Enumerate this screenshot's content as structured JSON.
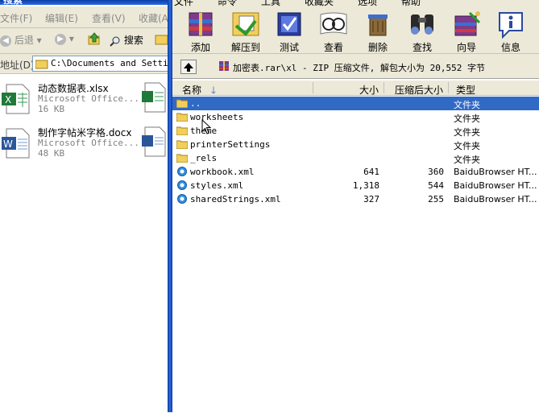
{
  "explorer": {
    "title": "搜索",
    "menu": [
      "文件(F)",
      "编辑(E)",
      "查看(V)",
      "收藏(A)"
    ],
    "nav": {
      "back_label": "后退",
      "search_label": "搜索"
    },
    "address": {
      "label": "地址(D)",
      "value": "C:\\Documents and Settings"
    },
    "files": [
      {
        "name": "动态数据表.xlsx",
        "desc": "Microsoft Office...",
        "size": "16 KB",
        "icon": "excel-file-icon"
      },
      {
        "name": "制作字帖米字格.docx",
        "desc": "Microsoft Office...",
        "size": "48 KB",
        "icon": "word-file-icon"
      }
    ]
  },
  "winrar": {
    "menu": [
      "文件",
      "命令",
      "工具",
      "收藏夹",
      "选项",
      "帮助"
    ],
    "toolbar": [
      {
        "label": "添加",
        "icon": "add-archive-icon"
      },
      {
        "label": "解压到",
        "icon": "extract-to-icon"
      },
      {
        "label": "测试",
        "icon": "test-icon"
      },
      {
        "label": "查看",
        "icon": "view-icon"
      },
      {
        "label": "删除",
        "icon": "delete-icon"
      },
      {
        "label": "查找",
        "icon": "find-icon"
      },
      {
        "label": "向导",
        "icon": "wizard-icon"
      },
      {
        "label": "信息",
        "icon": "info-icon"
      }
    ],
    "path": "加密表.rar\\xl - ZIP 压缩文件, 解包大小为 20,552 字节",
    "columns": {
      "name": "名称",
      "size": "大小",
      "packed": "压缩后大小",
      "type": "类型"
    },
    "rows": [
      {
        "name": "..",
        "size": "",
        "packed": "",
        "type": "文件夹",
        "kind": "folder",
        "selected": true
      },
      {
        "name": "worksheets",
        "size": "",
        "packed": "",
        "type": "文件夹",
        "kind": "folder"
      },
      {
        "name": "theme",
        "size": "",
        "packed": "",
        "type": "文件夹",
        "kind": "folder"
      },
      {
        "name": "printerSettings",
        "size": "",
        "packed": "",
        "type": "文件夹",
        "kind": "folder"
      },
      {
        "name": "_rels",
        "size": "",
        "packed": "",
        "type": "文件夹",
        "kind": "folder"
      },
      {
        "name": "workbook.xml",
        "size": "641",
        "packed": "360",
        "type": "BaiduBrowser HT...",
        "kind": "xml"
      },
      {
        "name": "styles.xml",
        "size": "1,318",
        "packed": "544",
        "type": "BaiduBrowser HT...",
        "kind": "xml"
      },
      {
        "name": "sharedStrings.xml",
        "size": "327",
        "packed": "255",
        "type": "BaiduBrowser HT...",
        "kind": "xml"
      }
    ],
    "colors": {
      "selection": "#316ac5",
      "face": "#ece9d8"
    }
  }
}
